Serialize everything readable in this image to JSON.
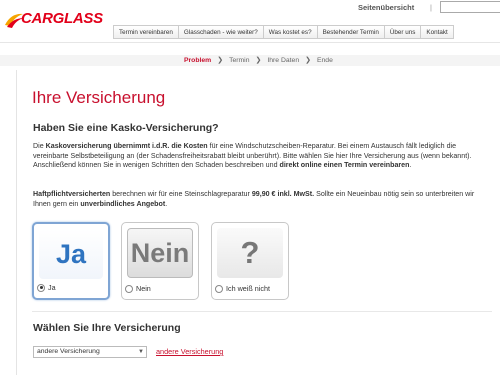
{
  "header": {
    "logo_text": "CARGLASS",
    "sitemap_label": "Seitenübersicht",
    "separator": "|",
    "search_value": ""
  },
  "nav": {
    "items": [
      "Termin vereinbaren",
      "Glasschaden - wie weiter?",
      "Was kostet es?",
      "Bestehender Termin",
      "Über uns",
      "Kontakt"
    ]
  },
  "steps": {
    "items": [
      "Problem",
      "Termin",
      "Ihre Daten",
      "Ende"
    ],
    "active_index": 0
  },
  "page": {
    "title": "Ihre Versicherung",
    "question": "Haben Sie eine Kasko-Versicherung?",
    "p1_a": "Die ",
    "p1_b": "Kaskoversicherung übernimmt i.d.R. die Kosten",
    "p1_c": " für eine Windschutzscheiben-Reparatur. Bei einem Austausch fällt lediglich die vereinbarte Selbstbeteiligung an (der Schadensfreiheitsrabatt bleibt unberührt). Bitte wählen Sie hier Ihre Versicherung aus (wenn bekannt). Anschließend können Sie in wenigen Schritten den Schaden beschreiben und ",
    "p1_d": "direkt online einen Termin vereinbaren",
    "p1_e": ".",
    "p2_a": "Haftpflichtversicherten",
    "p2_b": " berechnen wir für eine Steinschlagreparatur ",
    "p2_c": "99,90 € inkl. MwSt.",
    "p2_d": " Sollte ein Neueinbau nötig sein so unterbreiten wir Ihnen gern ein ",
    "p2_e": "unverbindliches Angebot",
    "p2_f": "."
  },
  "options": [
    {
      "tile": "Ja",
      "label": "Ja",
      "checked": true
    },
    {
      "tile": "Nein",
      "label": "Nein",
      "checked": false
    },
    {
      "tile": "?",
      "label": "Ich weiß nicht",
      "checked": false
    }
  ],
  "insurance": {
    "heading": "Wählen Sie Ihre Versicherung",
    "select_value": "andere Versicherung",
    "link_label": "andere Versicherung"
  },
  "colors": {
    "brand_red": "#c8102e",
    "selected_border": "#7fa5d4",
    "ja_blue": "#2f74c0"
  }
}
